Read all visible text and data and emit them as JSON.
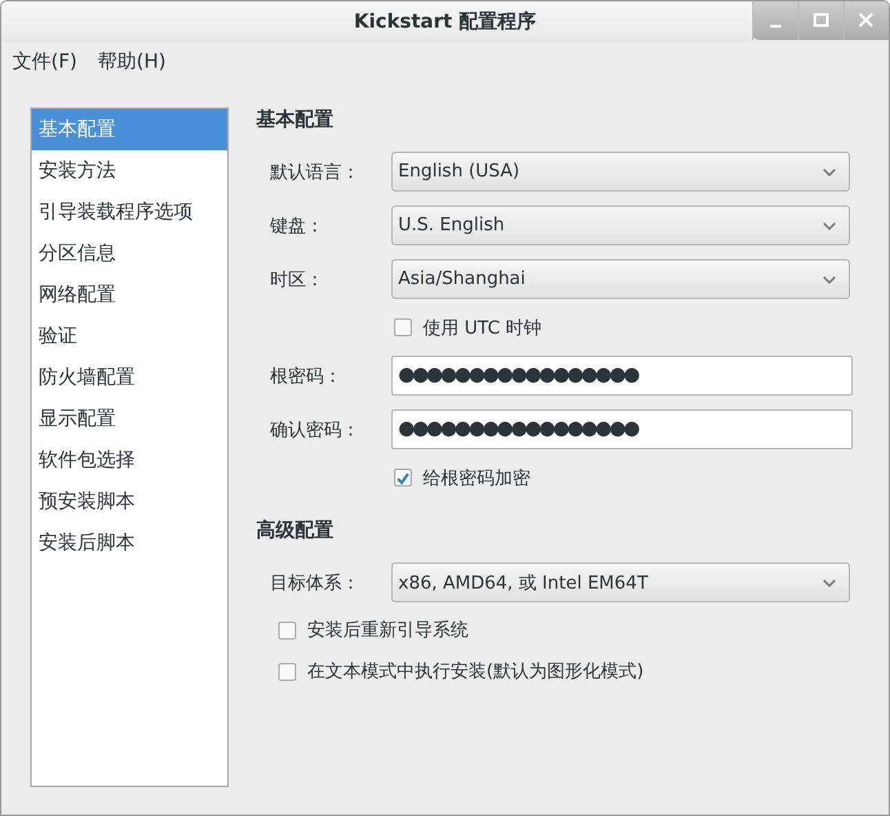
{
  "window": {
    "title": "Kickstart 配置程序"
  },
  "menu": [
    {
      "label": "文件(F)"
    },
    {
      "label": "帮助(H)"
    }
  ],
  "sidebar": {
    "items": [
      {
        "label": "基本配置",
        "selected": true
      },
      {
        "label": "安装方法",
        "selected": false
      },
      {
        "label": "引导装载程序选项",
        "selected": false
      },
      {
        "label": "分区信息",
        "selected": false
      },
      {
        "label": "网络配置",
        "selected": false
      },
      {
        "label": "验证",
        "selected": false
      },
      {
        "label": "防火墙配置",
        "selected": false
      },
      {
        "label": "显示配置",
        "selected": false
      },
      {
        "label": "软件包选择",
        "selected": false
      },
      {
        "label": "预安装脚本",
        "selected": false
      },
      {
        "label": "安装后脚本",
        "selected": false
      }
    ]
  },
  "sections": [
    {
      "title": "基本配置",
      "rows": [
        {
          "kind": "combo",
          "label": "默认语言：",
          "value": "English (USA)"
        },
        {
          "kind": "combo",
          "label": "键盘：",
          "value": "U.S. English"
        },
        {
          "kind": "combo",
          "label": "时区：",
          "value": "Asia/Shanghai"
        },
        {
          "kind": "check",
          "label": "使用  UTC 时钟",
          "checked": false
        },
        {
          "kind": "password",
          "label": "根密码：",
          "value": "●●●●●●●●●●●●●●●●●"
        },
        {
          "kind": "password",
          "label": "确认密码：",
          "value": "●●●●●●●●●●●●●●●●●"
        },
        {
          "kind": "check",
          "label": "给根密码加密",
          "checked": true
        }
      ]
    },
    {
      "title": "高级配置",
      "rows": [
        {
          "kind": "combo",
          "label": "目标体系：",
          "value": "x86, AMD64, 或 Intel EM64T"
        },
        {
          "kind": "wide-check",
          "label": "安装后重新引导系统",
          "checked": false
        },
        {
          "kind": "wide-check",
          "label": "在文本模式中执行安装(默认为图形化模式)",
          "checked": false
        }
      ]
    }
  ]
}
